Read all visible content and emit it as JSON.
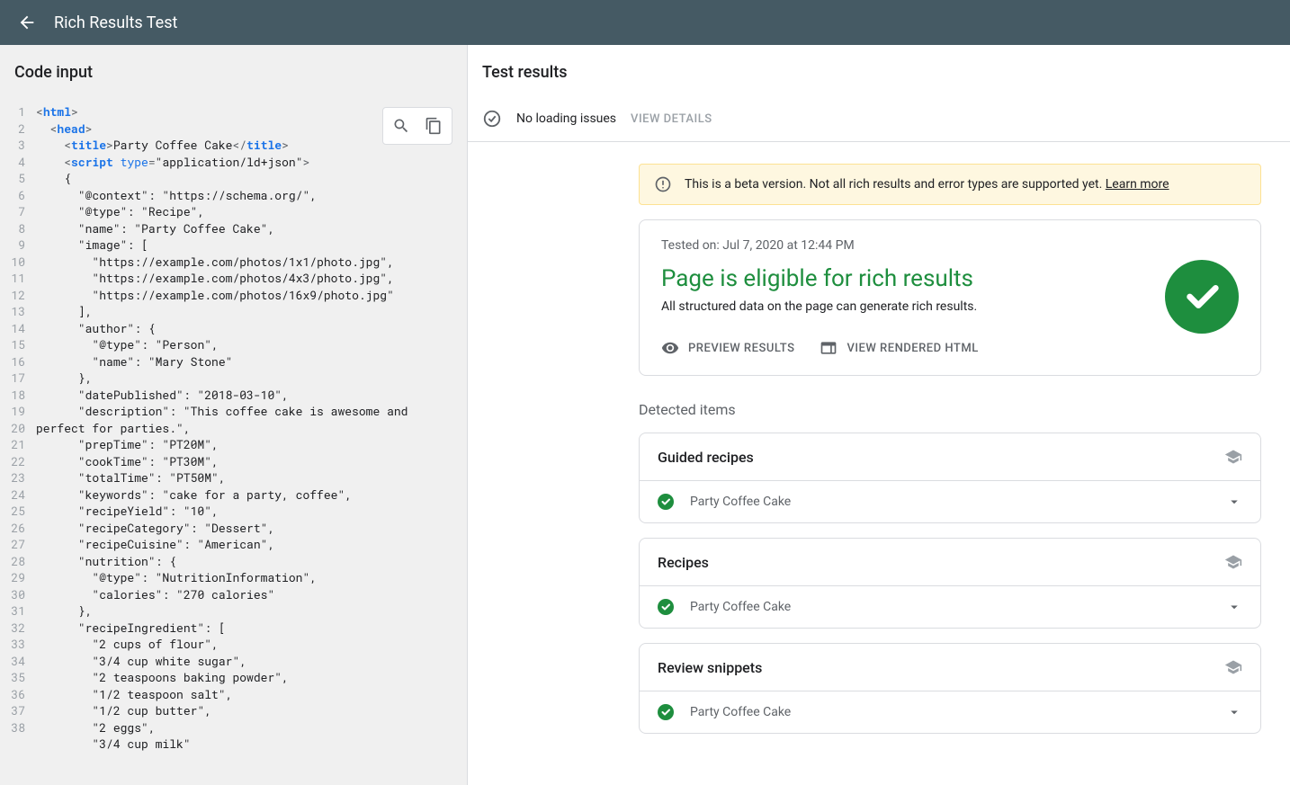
{
  "header": {
    "title": "Rich Results Test"
  },
  "left": {
    "title": "Code input"
  },
  "code": {
    "lines": [
      {
        "n": "1",
        "html": "<span class='punct'>&lt;</span><span class='tag'>html</span><span class='punct'>&gt;</span>"
      },
      {
        "n": "2",
        "html": "  <span class='punct'>&lt;</span><span class='tag'>head</span><span class='punct'>&gt;</span>"
      },
      {
        "n": "3",
        "html": "    <span class='punct'>&lt;</span><span class='tag'>title</span><span class='punct'>&gt;</span>Party Coffee Cake<span class='punct'>&lt;/</span><span class='tag'>title</span><span class='punct'>&gt;</span>"
      },
      {
        "n": "4",
        "html": "    <span class='punct'>&lt;</span><span class='tag'>script </span><span class='attr'>type</span><span class='punct'>=</span>\"application/ld+json\"<span class='punct'>&gt;</span>"
      },
      {
        "n": "5",
        "html": "    {"
      },
      {
        "n": "6",
        "html": "      \"@context\": \"https://schema.org/\","
      },
      {
        "n": "7",
        "html": "      \"@type\": \"Recipe\","
      },
      {
        "n": "8",
        "html": "      \"name\": \"Party Coffee Cake\","
      },
      {
        "n": "9",
        "html": "      \"image\": ["
      },
      {
        "n": "10",
        "html": "        \"https://example.com/photos/1x1/photo.jpg\","
      },
      {
        "n": "11",
        "html": "        \"https://example.com/photos/4x3/photo.jpg\","
      },
      {
        "n": "12",
        "html": "        \"https://example.com/photos/16x9/photo.jpg\""
      },
      {
        "n": "13",
        "html": "      ],"
      },
      {
        "n": "14",
        "html": "      \"author\": {"
      },
      {
        "n": "15",
        "html": "        \"@type\": \"Person\","
      },
      {
        "n": "16",
        "html": "        \"name\": \"Mary Stone\""
      },
      {
        "n": "17",
        "html": "      },"
      },
      {
        "n": "18",
        "html": "      \"datePublished\": \"2018-03-10\","
      },
      {
        "n": "19",
        "html": "      \"description\": \"This coffee cake is awesome and perfect for parties.\","
      },
      {
        "n": "20",
        "html": "      \"prepTime\": \"PT20M\","
      },
      {
        "n": "21",
        "html": "      \"cookTime\": \"PT30M\","
      },
      {
        "n": "22",
        "html": "      \"totalTime\": \"PT50M\","
      },
      {
        "n": "23",
        "html": "      \"keywords\": \"cake for a party, coffee\","
      },
      {
        "n": "24",
        "html": "      \"recipeYield\": \"10\","
      },
      {
        "n": "25",
        "html": "      \"recipeCategory\": \"Dessert\","
      },
      {
        "n": "26",
        "html": "      \"recipeCuisine\": \"American\","
      },
      {
        "n": "27",
        "html": "      \"nutrition\": {"
      },
      {
        "n": "28",
        "html": "        \"@type\": \"NutritionInformation\","
      },
      {
        "n": "29",
        "html": "        \"calories\": \"270 calories\""
      },
      {
        "n": "30",
        "html": "      },"
      },
      {
        "n": "31",
        "html": "      \"recipeIngredient\": ["
      },
      {
        "n": "32",
        "html": "        \"2 cups of flour\","
      },
      {
        "n": "33",
        "html": "        \"3/4 cup white sugar\","
      },
      {
        "n": "34",
        "html": "        \"2 teaspoons baking powder\","
      },
      {
        "n": "35",
        "html": "        \"1/2 teaspoon salt\","
      },
      {
        "n": "36",
        "html": "        \"1/2 cup butter\","
      },
      {
        "n": "37",
        "html": "        \"2 eggs\","
      },
      {
        "n": "38",
        "html": "        \"3/4 cup milk\""
      }
    ]
  },
  "right": {
    "title": "Test results"
  },
  "loading": {
    "status": "No loading issues",
    "viewDetails": "VIEW DETAILS"
  },
  "beta": {
    "text": "This is a beta version. Not all rich results and error types are supported yet. ",
    "link": "Learn more"
  },
  "result": {
    "testedOn": "Tested on: Jul 7, 2020 at 12:44 PM",
    "title": "Page is eligible for rich results",
    "subtitle": "All structured data on the page can generate rich results.",
    "preview": "PREVIEW RESULTS",
    "rendered": "VIEW RENDERED HTML"
  },
  "detected": {
    "title": "Detected items",
    "groups": [
      {
        "title": "Guided recipes",
        "item": "Party Coffee Cake"
      },
      {
        "title": "Recipes",
        "item": "Party Coffee Cake"
      },
      {
        "title": "Review snippets",
        "item": "Party Coffee Cake"
      }
    ]
  }
}
